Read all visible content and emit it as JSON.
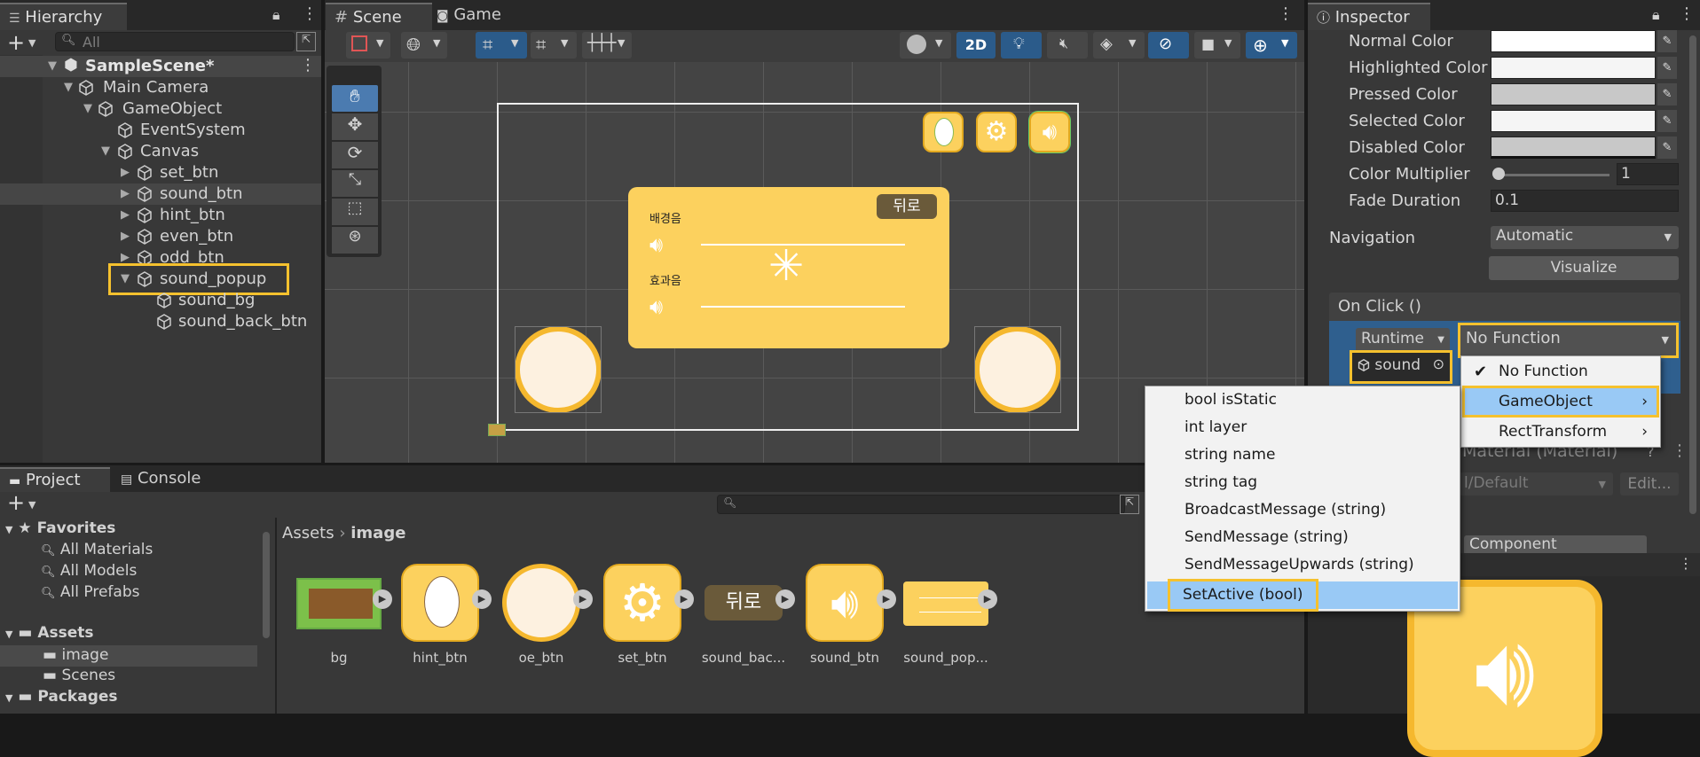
{
  "hierarchy": {
    "tab": "Hierarchy",
    "search_placeholder": "All",
    "scene": "SampleScene*",
    "items": [
      {
        "label": "Main Camera"
      },
      {
        "label": "GameObject"
      },
      {
        "label": "EventSystem"
      },
      {
        "label": "Canvas"
      },
      {
        "label": "set_btn"
      },
      {
        "label": "sound_btn"
      },
      {
        "label": "hint_btn"
      },
      {
        "label": "even_btn"
      },
      {
        "label": "odd_btn"
      },
      {
        "label": "sound_popup"
      },
      {
        "label": "sound_bg"
      },
      {
        "label": "sound_back_btn"
      }
    ]
  },
  "scene_view": {
    "tabs": [
      "Scene",
      "Game"
    ],
    "toolbar_2d": "2D",
    "popup": {
      "back_label": "뒤로",
      "bgm_label": "배경음",
      "sfx_label": "효과음"
    }
  },
  "inspector": {
    "tab": "Inspector",
    "colors": [
      {
        "label": "Normal Color"
      },
      {
        "label": "Highlighted Color"
      },
      {
        "label": "Pressed Color"
      },
      {
        "label": "Selected Color"
      },
      {
        "label": "Disabled Color"
      }
    ],
    "color_multiplier_label": "Color Multiplier",
    "color_multiplier_value": "1",
    "fade_duration_label": "Fade Duration",
    "fade_duration_value": "0.1",
    "navigation_label": "Navigation",
    "navigation_value": "Automatic",
    "visualize_label": "Visualize",
    "on_click_label": "On Click ()",
    "runtime_label": "Runtime",
    "function_value": "No Function",
    "object_field": "sound",
    "material_label": "Material (Material)",
    "material_value": "l/Default",
    "edit_label": "Edit...",
    "add_component": "Component"
  },
  "function_menu": {
    "items": [
      "No Function",
      "GameObject",
      "RectTransform"
    ],
    "selected": "No Function",
    "highlighted": "GameObject"
  },
  "gameobject_submenu": {
    "items": [
      "bool isStatic",
      "int layer",
      "string name",
      "string tag",
      "BroadcastMessage (string)",
      "SendMessage (string)",
      "SendMessageUpwards (string)",
      "SetActive (bool)"
    ],
    "highlighted": "SetActive (bool)"
  },
  "project": {
    "tabs": [
      "Project",
      "Console"
    ],
    "favorites_label": "Favorites",
    "favorites": [
      "All Materials",
      "All Models",
      "All Prefabs"
    ],
    "assets_label": "Assets",
    "assets_children": [
      "image",
      "Scenes"
    ],
    "packages_label": "Packages",
    "breadcrumb": [
      "Assets",
      "image"
    ],
    "assets": [
      {
        "name": "bg"
      },
      {
        "name": "hint_btn"
      },
      {
        "name": "oe_btn"
      },
      {
        "name": "set_btn"
      },
      {
        "name": "sound_bac..."
      },
      {
        "name": "sound_btn"
      },
      {
        "name": "sound_pop..."
      }
    ],
    "back_thumb_text": "뒤로"
  },
  "colors": {
    "highlight": "#f5c12e",
    "button_yellow": "#fcd15e",
    "selection_blue": "#99c9f5"
  }
}
